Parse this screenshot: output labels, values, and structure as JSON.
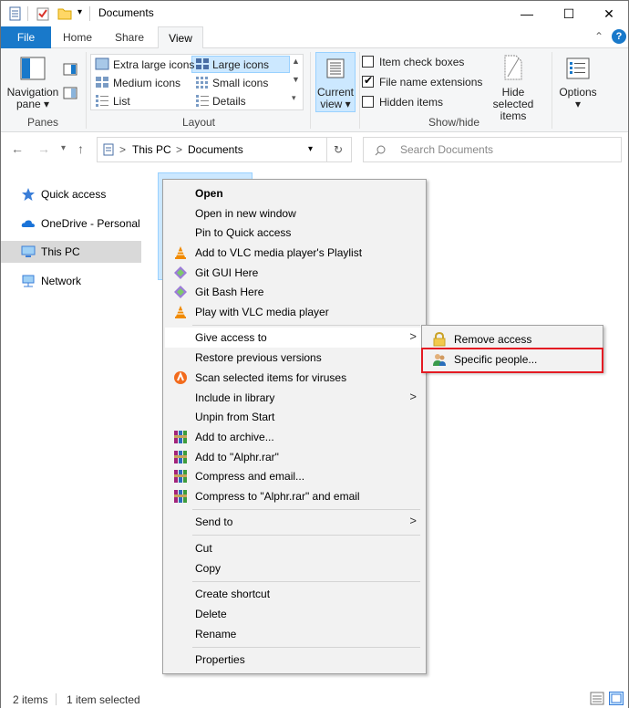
{
  "window": {
    "title": "Documents",
    "controls": {
      "minimize": "—",
      "maximize": "☐",
      "close": "✕"
    }
  },
  "ribbon_tabs": {
    "file": "File",
    "home": "Home",
    "share": "Share",
    "view": "View",
    "expand": "⌃",
    "help": "?"
  },
  "ribbon": {
    "panes": {
      "nav_pane_label_line1": "Navigation",
      "nav_pane_label_line2": "pane ▾",
      "group": "Panes"
    },
    "layout": {
      "items": [
        "Extra large icons",
        "Large icons",
        "Medium icons",
        "Small icons",
        "List",
        "Details"
      ],
      "group": "Layout"
    },
    "current_view": {
      "line1": "Current",
      "line2": "view ▾"
    },
    "show_hide": {
      "item_check_boxes": "Item check boxes",
      "file_name_extensions": "File name extensions",
      "hidden_items": "Hidden items",
      "hide_selected_line1": "Hide selected",
      "hide_selected_line2": "items",
      "group": "Show/hide"
    },
    "options": {
      "label": "Options",
      "arrow": "▾"
    }
  },
  "address": {
    "path_pc": "This PC",
    "path_sep": ">",
    "path_folder": "Documents",
    "search_placeholder": "Search Documents"
  },
  "nav_pane": {
    "items": [
      "Quick access",
      "OneDrive - Personal",
      "This PC",
      "Network"
    ]
  },
  "context_menu": {
    "items": [
      "Open",
      "Open in new window",
      "Pin to Quick access",
      "Add to VLC media player's Playlist",
      "Git GUI Here",
      "Git Bash Here",
      "Play with VLC media player",
      "Give access to",
      "Restore previous versions",
      "Scan selected items for viruses",
      "Include in library",
      "Unpin from Start",
      "Add to archive...",
      "Add to \"Alphr.rar\"",
      "Compress and email...",
      "Compress to \"Alphr.rar\" and email",
      "Send to",
      "Cut",
      "Copy",
      "Create shortcut",
      "Delete",
      "Rename",
      "Properties"
    ],
    "arrow": ">"
  },
  "submenu": {
    "items": [
      "Remove access",
      "Specific people..."
    ]
  },
  "status": {
    "count": "2 items",
    "selected": "1 item selected"
  },
  "colors": {
    "accent": "#1979ca",
    "selection": "#cce8ff",
    "highlight_box": "#e41b23"
  }
}
